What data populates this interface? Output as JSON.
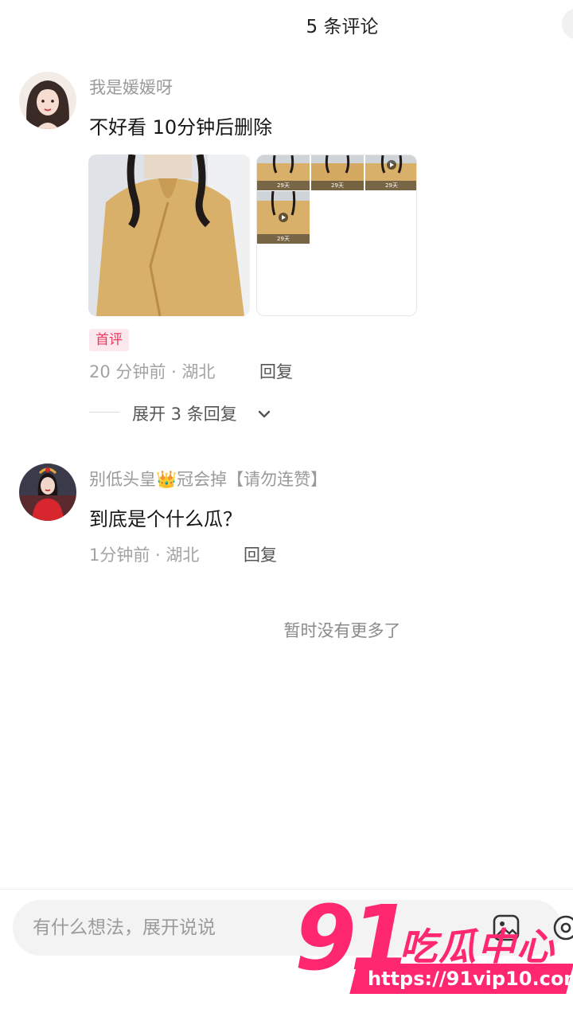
{
  "header": {
    "title": "5 条评论"
  },
  "comments": [
    {
      "username": "我是媛媛呀",
      "text": "不好看 10分钟后删除",
      "badge": "首评",
      "meta": "20 分钟前 · 湖北",
      "reply_label": "回复",
      "expand_label": "展开 3 条回复",
      "thumb_captions": [
        "29天",
        "29天",
        "29天",
        "29天"
      ]
    },
    {
      "username_prefix": "别低头皇",
      "username_emoji": "👑",
      "username_suffix": "冠会掉【请勿连赞】",
      "text": "到底是个什么瓜？",
      "meta": "1分钟前 · 湖北",
      "reply_label": "回复"
    }
  ],
  "end_note": "暂时没有更多了",
  "input": {
    "placeholder": "有什么想法，展开说说"
  },
  "watermark": {
    "number": "91",
    "text": "吃瓜中心",
    "url": "https://91vip10.com"
  },
  "colors": {
    "badge": "#f0355f",
    "watermark": "#ff2770",
    "shirt": "#d9b06a"
  }
}
